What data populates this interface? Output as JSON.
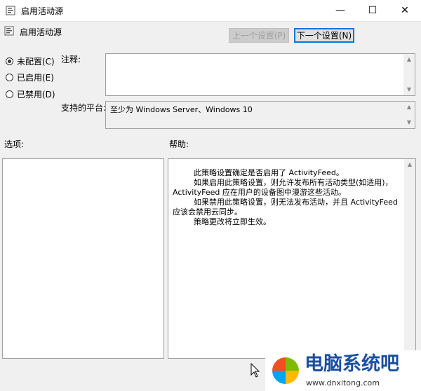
{
  "window": {
    "title": "启用活动源",
    "minimize": "—",
    "maximize": "☐",
    "close": "✕"
  },
  "header": {
    "policy_name": "启用活动源",
    "prev_button": "上一个设置(P)",
    "next_button": "下一个设置(N)"
  },
  "state": {
    "options": [
      {
        "label": "未配置(C)",
        "checked": true
      },
      {
        "label": "已启用(E)",
        "checked": false
      },
      {
        "label": "已禁用(D)",
        "checked": false
      }
    ]
  },
  "comment": {
    "label": "注释:",
    "value": ""
  },
  "platform": {
    "label": "支持的平台:",
    "value": "至少为 Windows Server、Windows 10"
  },
  "options_section": {
    "label": "选项:"
  },
  "help_section": {
    "label": "帮助:",
    "paragraphs": [
      "此策略设置确定是否启用了 ActivityFeed。",
      "如果启用此策略设置，则允许发布所有活动类型(如适用)，ActivityFeed 应在用户的设备图中漫游这些活动。",
      "如果禁用此策略设置，则无法发布活动，并且 ActivityFeed 应该会禁用云同步。",
      "策略更改将立即生效。"
    ]
  },
  "watermark": {
    "name": "电脑系统吧",
    "url": "www.dnxitong.com"
  },
  "colors": {
    "accent": "#0078d7",
    "dialog_bg": "#f0f0f0"
  }
}
